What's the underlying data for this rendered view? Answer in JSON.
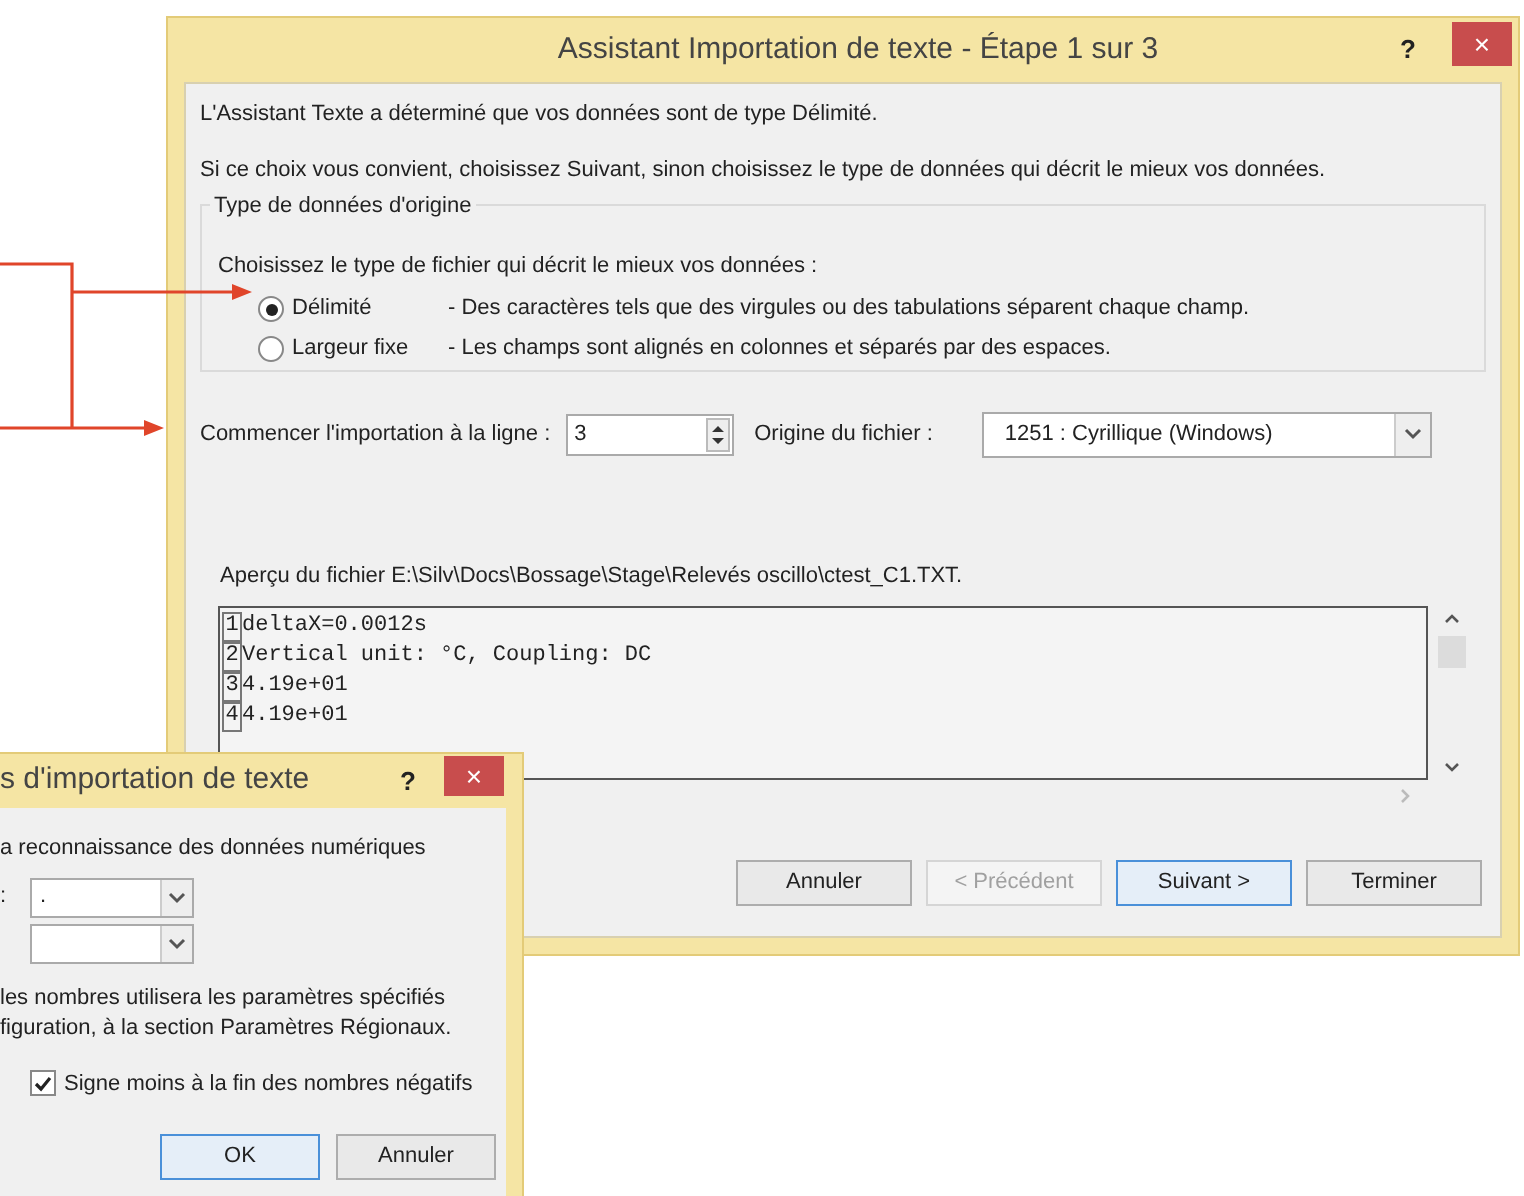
{
  "main_dialog": {
    "title": "Assistant Importation de texte - Étape 1 sur 3",
    "help": "?",
    "close": "×",
    "intro": [
      "L'Assistant Texte a déterminé que vos données sont de type Délimité.",
      "Si ce choix vous convient, choisissez Suivant, sinon choisissez le type de données qui décrit le mieux vos données."
    ],
    "group": {
      "title": "Type de données d'origine",
      "prompt": "Choisissez le type de fichier qui décrit le mieux vos données :",
      "options": [
        {
          "label": "Délimité",
          "description": "- Des caractères tels que des virgules ou des tabulations séparent chaque champ.",
          "selected": true
        },
        {
          "label": "Largeur fixe",
          "description": "- Les champs sont alignés en colonnes et séparés par des espaces.",
          "selected": false
        }
      ]
    },
    "start_row": {
      "label": "Commencer l'importation à la ligne :",
      "value": "3"
    },
    "origin": {
      "label": "Origine du fichier :",
      "value": "1251 : Cyrillique (Windows)"
    },
    "preview": {
      "label": "Aperçu du fichier E:\\Silv\\Docs\\Bossage\\Stage\\Relevés oscillo\\ctest_C1.TXT.",
      "lines": [
        {
          "number": "1",
          "text": "deltaX=0.0012s"
        },
        {
          "number": "2",
          "text": "Vertical unit: °C, Coupling: DC"
        },
        {
          "number": "3",
          "text": "4.19e+01"
        },
        {
          "number": "4",
          "text": "4.19e+01"
        }
      ]
    },
    "buttons": [
      {
        "label": "Annuler",
        "disabled": false,
        "focused": false
      },
      {
        "label": "< Précédent",
        "disabled": true,
        "focused": false
      },
      {
        "label": "Suivant >",
        "disabled": false,
        "focused": true
      },
      {
        "label": "Terminer",
        "disabled": false,
        "focused": false
      }
    ]
  },
  "numeric_dialog": {
    "title": "s d'importation de texte",
    "help": "?",
    "close": "×",
    "section": "a reconnaissance des données numériques",
    "fields": [
      {
        "kind": "dropdown",
        "label": ":",
        "value": "."
      },
      {
        "kind": "dropdown"
      }
    ],
    "note": [
      "les nombres utilisera les paramètres spécifiés",
      "figuration, à la section Paramètres Régionaux."
    ],
    "checkbox": {
      "label": "Signe moins à la fin des nombres négatifs",
      "checked": true
    },
    "buttons": [
      {
        "label": "OK",
        "focused": true
      },
      {
        "label": "Annuler",
        "focused": false
      }
    ]
  }
}
